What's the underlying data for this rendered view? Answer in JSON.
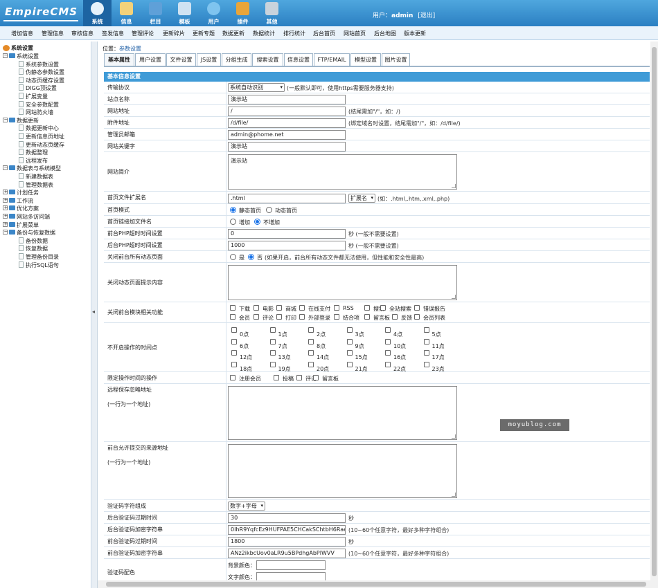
{
  "brand": {
    "logo_text": "EmpireCMS"
  },
  "nav": [
    {
      "label": "系统",
      "icon": "globe-icon",
      "active": true
    },
    {
      "label": "信息",
      "icon": "notepad-icon",
      "active": false
    },
    {
      "label": "栏目",
      "icon": "folder-icon",
      "active": false
    },
    {
      "label": "模板",
      "icon": "template-window-icon",
      "active": false
    },
    {
      "label": "用户",
      "icon": "user-icon",
      "active": false
    },
    {
      "label": "插件",
      "icon": "plugin-tools-icon",
      "active": false
    },
    {
      "label": "其他",
      "icon": "gear-icon",
      "active": false
    }
  ],
  "user": {
    "prefix": "用户：",
    "name": "admin",
    "logout": "[退出]"
  },
  "menu": [
    "增加信息",
    "管理信息",
    "审核信息",
    "签发信息",
    "管理评论",
    "更新碎片",
    "更新专题",
    "数据更新",
    "数据统计",
    "排行统计",
    "后台首页",
    "网站首页",
    "后台地图",
    "版本更新"
  ],
  "tree": {
    "root": "系统设置",
    "groups": [
      {
        "label": "系统设置",
        "expanded": true,
        "items": [
          "系统参数设置",
          "伪静态参数设置",
          "动态页缓存设置",
          "DIGG顶设置",
          "扩展变量",
          "安全参数配置",
          "网站防火墙"
        ]
      },
      {
        "label": "数据更新",
        "expanded": true,
        "items": [
          "数据更新中心",
          "更新信息页地址",
          "更新动态页缓存",
          "数据整理",
          "远程发布"
        ]
      },
      {
        "label": "数据表与系统模型",
        "expanded": true,
        "items": [
          "新建数据表",
          "管理数据表"
        ]
      },
      {
        "label": "计划任务",
        "expanded": false,
        "items": []
      },
      {
        "label": "工作流",
        "expanded": false,
        "items": []
      },
      {
        "label": "优化方案",
        "expanded": false,
        "items": []
      },
      {
        "label": "网站多访问端",
        "expanded": false,
        "items": []
      },
      {
        "label": "扩展菜单",
        "expanded": false,
        "items": []
      },
      {
        "label": "备份与恢复数据",
        "expanded": true,
        "items": [
          "备份数据",
          "恢复数据",
          "管理备份目录",
          "执行SQL语句"
        ]
      }
    ]
  },
  "location": {
    "prefix": "位置：",
    "link": "参数设置"
  },
  "tabs": [
    "基本属性",
    "用户设置",
    "文件设置",
    "JS设置",
    "分组生成",
    "搜索设置",
    "信息设置",
    "FTP/EMAIL",
    "模型设置",
    "图片设置"
  ],
  "section_title": "基本信息设置",
  "fields": {
    "protocol": {
      "label": "传输协议",
      "value": "系统自动识别",
      "hint": "(一般默认即可，使用https需要服务器支持)"
    },
    "site_name": {
      "label": "站点名称",
      "value": "演示站"
    },
    "site_url": {
      "label": "网站地址",
      "value": "/",
      "hint": "(结尾需加\"/\"，如：/)"
    },
    "attach_url": {
      "label": "附件地址",
      "value": "/d/file/",
      "hint": "(绑定域名时设置，结尾需加\"/\"，如：/d/file/)"
    },
    "admin_email": {
      "label": "管理员邮箱",
      "value": "admin@phome.net"
    },
    "keywords": {
      "label": "网站关键字",
      "value": "演示站"
    },
    "intro": {
      "label": "网站简介",
      "value": "演示站"
    },
    "index_ext": {
      "label": "首页文件扩展名",
      "value": ".html",
      "select": "扩展名",
      "hint": "(如：.html,.htm,.xml,.php)"
    },
    "index_mode": {
      "label": "首页模式",
      "options": [
        "静态首页",
        "动态首页"
      ],
      "selected": 0
    },
    "index_link": {
      "label": "首页链接加文件名",
      "options": [
        "增加",
        "不增加"
      ],
      "selected": 1
    },
    "front_php_timeout": {
      "label": "前台PHP超时时间设置",
      "value": "0",
      "hint": "秒 (一般不需要设置)"
    },
    "back_php_timeout": {
      "label": "后台PHP超时时间设置",
      "value": "1000",
      "hint": "秒 (一般不需要设置)"
    },
    "close_dynamic": {
      "label": "关闭前台所有动态页面",
      "options": [
        "是",
        "否"
      ],
      "selected": 1,
      "hint": "(如果开启，前台所有动态文件都无法使用，但性能和安全性最高)"
    },
    "close_tip": {
      "label": "关闭动态页面提示内容",
      "value": ""
    },
    "close_modules": {
      "label": "关闭前台模块相关功能",
      "row1": [
        "下载",
        "电影",
        "商城",
        "在线支付",
        "RSS",
        "搜索",
        "全站搜索",
        "错误报告"
      ],
      "row2": [
        "会员",
        "评论",
        "打印",
        "外部登录",
        "结合项",
        "留言板",
        "反馈",
        "会员列表"
      ]
    },
    "closed_hours": {
      "label": "不开启操作的时间点",
      "hours": [
        "0点",
        "1点",
        "2点",
        "3点",
        "4点",
        "5点",
        "6点",
        "7点",
        "8点",
        "9点",
        "10点",
        "11点",
        "12点",
        "13点",
        "14点",
        "15点",
        "16点",
        "17点",
        "18点",
        "19点",
        "20点",
        "21点",
        "22点",
        "23点"
      ]
    },
    "limit_ops": {
      "label": "限定操作时间的操作",
      "options": [
        "注册会员",
        "投稿",
        "评论",
        "留言板"
      ]
    },
    "remote_ignore": {
      "label": "远程保存忽略地址",
      "sub": "(一行为一个地址)",
      "value": ""
    },
    "allowed_sources": {
      "label": "前台允许提交的来源地址",
      "sub": "(一行为一个地址)",
      "value": ""
    },
    "captcha_chars": {
      "label": "验证码字符组成",
      "value": "数字+字母"
    },
    "back_captcha_expire": {
      "label": "后台验证码过期时间",
      "value": "30",
      "hint": "秒"
    },
    "back_captcha_key": {
      "label": "后台验证码加密字符串",
      "value": "0IhR9YqfcEz9HUFPAE5CHCakSChtbH6RaeRy",
      "hint": "(10~60个任意字符，最好多种字符组合)"
    },
    "front_captcha_expire": {
      "label": "前台验证码过期时间",
      "value": "1800",
      "hint": "秒"
    },
    "front_captcha_key": {
      "label": "前台验证码加密字符串",
      "value": "ANz2ikbcUov0aLR9u5BPdhgAbPlWVV",
      "hint": "(10~60个任意字符，最好多种字符组合)"
    },
    "captcha_color": {
      "label": "验证码配色",
      "bg": "背景颜色：",
      "fg": "文字颜色："
    }
  },
  "watermark": "moyublog.com",
  "colors": {
    "topbar": "#2b7fc2",
    "section": "#3f9bd7",
    "radio_on": "#1a73e8"
  }
}
